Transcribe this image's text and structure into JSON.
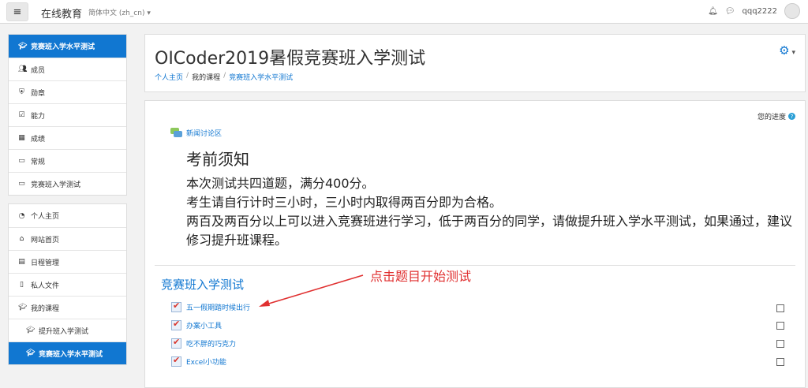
{
  "topbar": {
    "brand": "在线教育",
    "language": "简体中文 (zh_cn)",
    "username": "qqq2222"
  },
  "sidebar": {
    "course_nav": [
      {
        "label": "竞赛班入学水平测试",
        "icon": "graduation-cap-icon",
        "active": true
      },
      {
        "label": "成员",
        "icon": "users-icon"
      },
      {
        "label": "勋章",
        "icon": "shield-icon"
      },
      {
        "label": "能力",
        "icon": "checkbox-icon"
      },
      {
        "label": "成绩",
        "icon": "table-icon"
      },
      {
        "label": "常规",
        "icon": "folder-icon"
      },
      {
        "label": "竞赛班入学测试",
        "icon": "folder-icon"
      }
    ],
    "site_nav": [
      {
        "label": "个人主页",
        "icon": "tachometer-icon"
      },
      {
        "label": "网站首页",
        "icon": "home-icon"
      },
      {
        "label": "日程管理",
        "icon": "calendar-icon"
      },
      {
        "label": "私人文件",
        "icon": "file-icon"
      },
      {
        "label": "我的课程",
        "icon": "graduation-cap-icon"
      },
      {
        "label": "提升班入学测试",
        "icon": "graduation-cap-icon"
      },
      {
        "label": "竞赛班入学水平测试",
        "icon": "graduation-cap-icon",
        "active": true
      }
    ]
  },
  "header": {
    "title": "OICoder2019暑假竞赛班入学测试",
    "breadcrumb": [
      "个人主页",
      "我的课程",
      "竞赛班入学水平测试"
    ]
  },
  "main": {
    "progress_label": "您的进度",
    "forum_link": "新闻讨论区",
    "notice_title": "考前须知",
    "notice_lines": [
      "本次测试共四道题，满分400分。",
      "考生请自行计时三小时，三小时内取得两百分即为合格。",
      "两百及两百分以上可以进入竞赛班进行学习，低于两百分的同学，请做提升班入学水平测试，如果通过，建议修习提升班课程。"
    ],
    "section_title": "竞赛班入学测试",
    "annotation": "点击题目开始测试",
    "activities": [
      "五一假期踏时候出行",
      "办案小工具",
      "吃不胖的巧克力",
      "Excel小功能"
    ]
  },
  "colors": {
    "accent": "#1177d1",
    "annotation": "#e03030"
  }
}
